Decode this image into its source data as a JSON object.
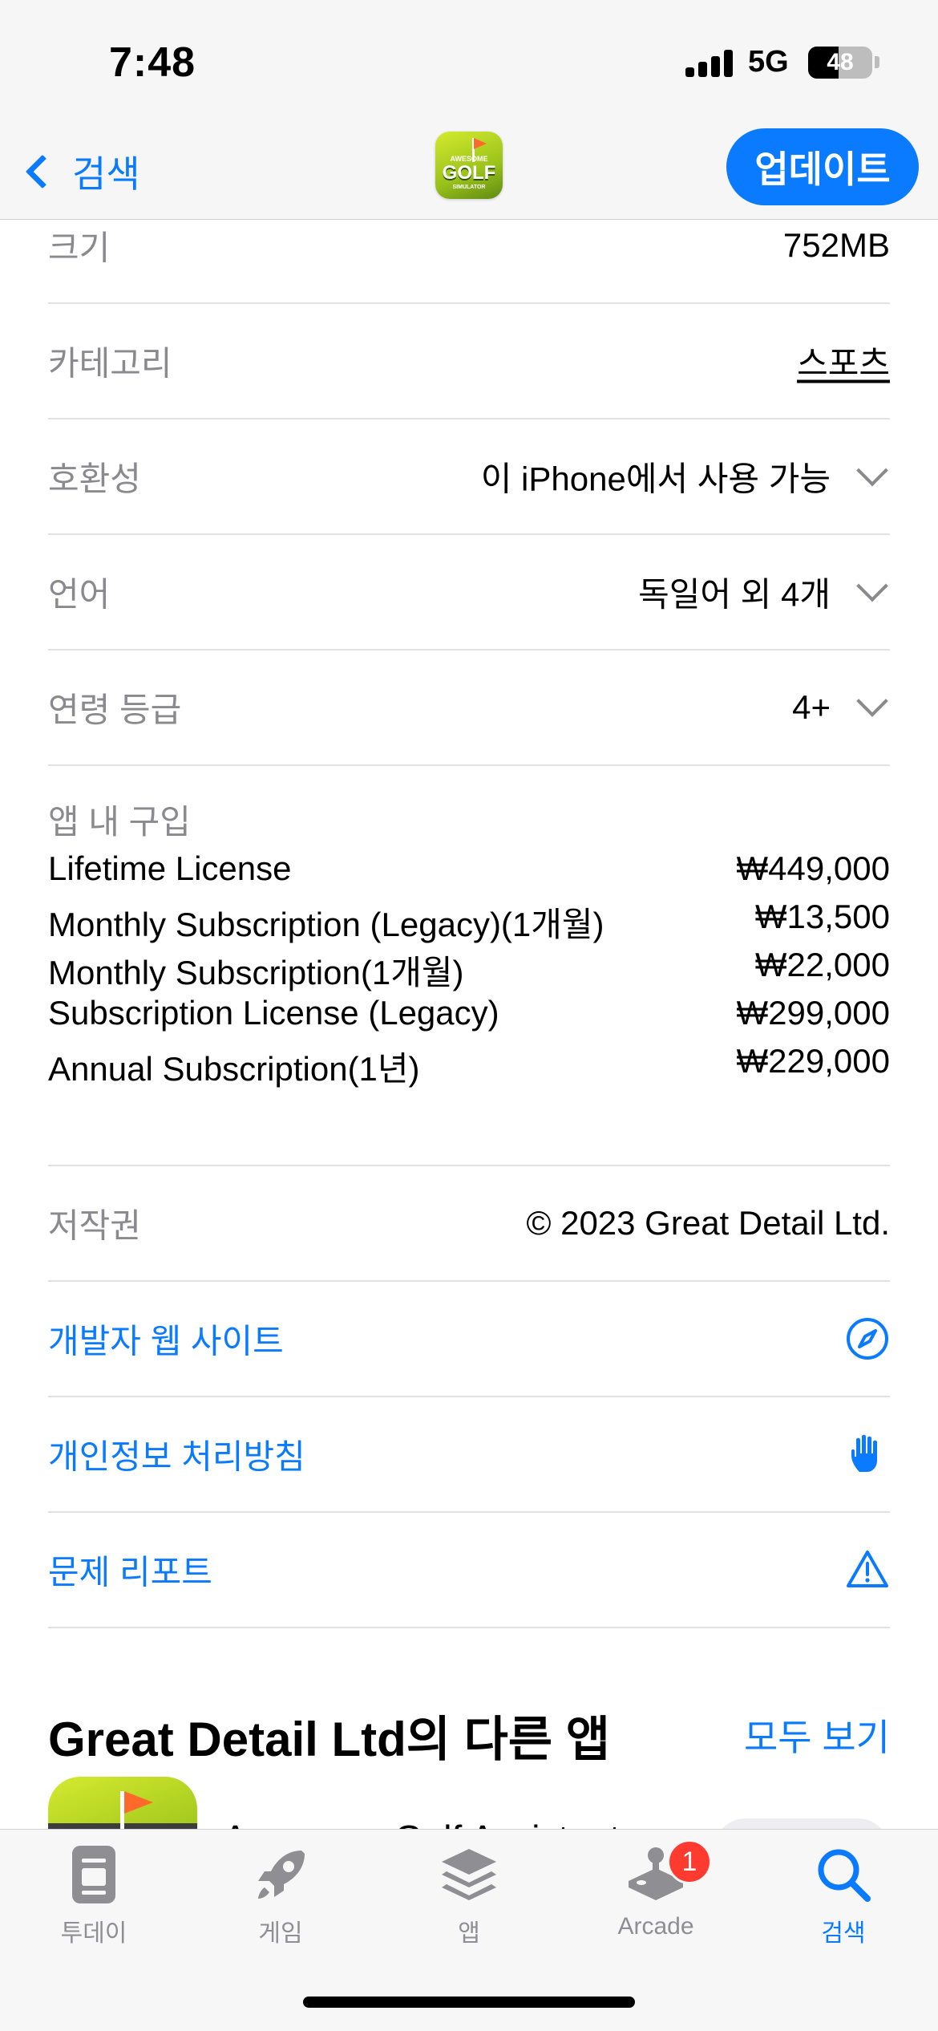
{
  "status_bar": {
    "time": "7:48",
    "network": "5G",
    "battery": "48",
    "battery_level": 0.48
  },
  "nav": {
    "back_label": "검색",
    "update_label": "업데이트"
  },
  "info_rows": [
    {
      "label": "크기",
      "value": "752MB"
    },
    {
      "label": "카테고리",
      "value": "스포츠"
    },
    {
      "label": "호환성",
      "value": "이 iPhone에서 사용 가능"
    },
    {
      "label": "언어",
      "value": "독일어 외 4개"
    },
    {
      "label": "연령 등급",
      "value": "4+"
    }
  ],
  "in_app_purchases": {
    "title": "앱 내 구입",
    "items": [
      {
        "name": "Lifetime License",
        "price": "₩449,000"
      },
      {
        "name": "Monthly Subscription (Legacy)(1개월)",
        "price": "₩13,500"
      },
      {
        "name": "Monthly Subscription(1개월)",
        "price": "₩22,000"
      },
      {
        "name": "Subscription License (Legacy)",
        "price": "₩299,000"
      },
      {
        "name": "Annual Subscription(1년)",
        "price": "₩229,000"
      }
    ]
  },
  "copyright": {
    "label": "저작권",
    "value": "© 2023 Great Detail Ltd."
  },
  "links": [
    {
      "label": "개발자 웹 사이트",
      "icon": "compass-icon"
    },
    {
      "label": "개인정보 처리방침",
      "icon": "hand-icon"
    },
    {
      "label": "문제 리포트",
      "icon": "warning-icon"
    }
  ],
  "more_apps": {
    "title": "Great Detail Ltd의 다른 앱",
    "see_all": "모두 보기",
    "first_app_name": "Awesome Golf Assistant"
  },
  "tabs": [
    {
      "label": "투데이",
      "icon": "today-icon"
    },
    {
      "label": "게임",
      "icon": "rocket-icon"
    },
    {
      "label": "앱",
      "icon": "apps-stack-icon"
    },
    {
      "label": "Arcade",
      "icon": "arcade-joystick-icon",
      "badge": "1"
    },
    {
      "label": "검색",
      "icon": "search-icon",
      "active": true
    }
  ],
  "colors": {
    "accent": "#0a7aff",
    "badge": "#ff3b30",
    "secondary_text": "#8a8a8e"
  }
}
